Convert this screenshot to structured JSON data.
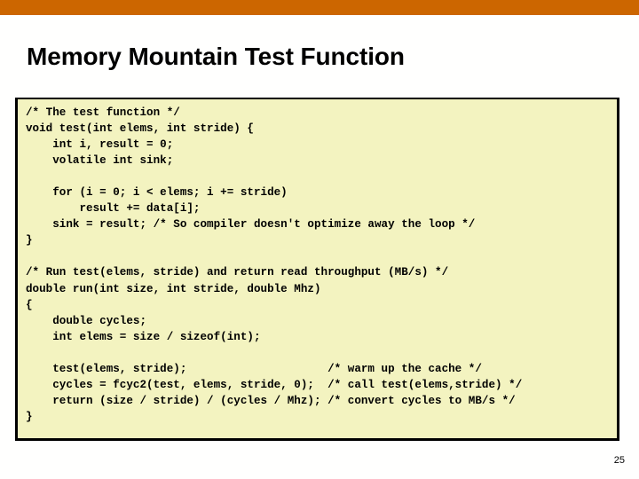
{
  "slide": {
    "title": "Memory Mountain Test Function",
    "number": "25",
    "accent_color": "#CC6600",
    "code_background_color": "#F3F3C0",
    "code_border_color": "#000000",
    "page_background_color": "#FFFFFE"
  },
  "code": {
    "language": "c",
    "lines": [
      "/* The test function */",
      "void test(int elems, int stride) {",
      "    int i, result = 0;",
      "    volatile int sink;",
      "",
      "    for (i = 0; i < elems; i += stride)",
      "        result += data[i];",
      "    sink = result; /* So compiler doesn't optimize away the loop */",
      "}",
      "",
      "/* Run test(elems, stride) and return read throughput (MB/s) */",
      "double run(int size, int stride, double Mhz)",
      "{",
      "    double cycles;",
      "    int elems = size / sizeof(int);",
      "",
      "    test(elems, stride);                     /* warm up the cache */",
      "    cycles = fcyc2(test, elems, stride, 0);  /* call test(elems,stride) */",
      "    return (size / stride) / (cycles / Mhz); /* convert cycles to MB/s */",
      "}"
    ]
  }
}
